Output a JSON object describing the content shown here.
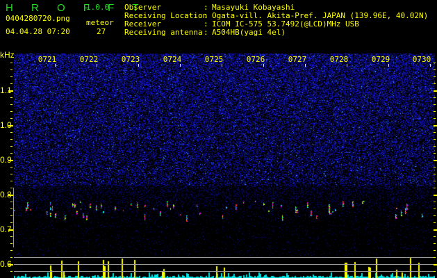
{
  "header": {
    "app_title": "H R O F F T",
    "version": "1.0.0",
    "filename": "0404280720.png",
    "datetime": "04.04.28 07:20",
    "meteor_label": "meteor",
    "meteor_count": "27",
    "info": [
      {
        "label": "Observer",
        "value": "Masayuki Kobayashi"
      },
      {
        "label": "Receiving Location",
        "value": "Ogata-vill. Akita-Pref. JAPAN (139.96E, 40.02N)"
      },
      {
        "label": "Receiver",
        "value": "ICOM IC-575 53.7492(@LCD)MHz USB"
      },
      {
        "label": "Receiving antenna",
        "value": "A504HB(yagi 4el)"
      }
    ]
  },
  "spectrogram": {
    "unit": "kHz",
    "freq_labels": [
      "1.1",
      "1.0",
      "0.9",
      "0.8",
      "0.7",
      "0.6"
    ],
    "time_labels": [
      "0721",
      "0722",
      "0723",
      "0724",
      "0725",
      "0726",
      "0727",
      "0728",
      "0729",
      "0730"
    ]
  },
  "colors": {
    "text": "#ffff00",
    "title": "#22dd22",
    "noise": "#1a1aff",
    "histogram_main": "#00e5e5",
    "histogram_meteor": "#ffff00",
    "grid": "#999999"
  }
}
